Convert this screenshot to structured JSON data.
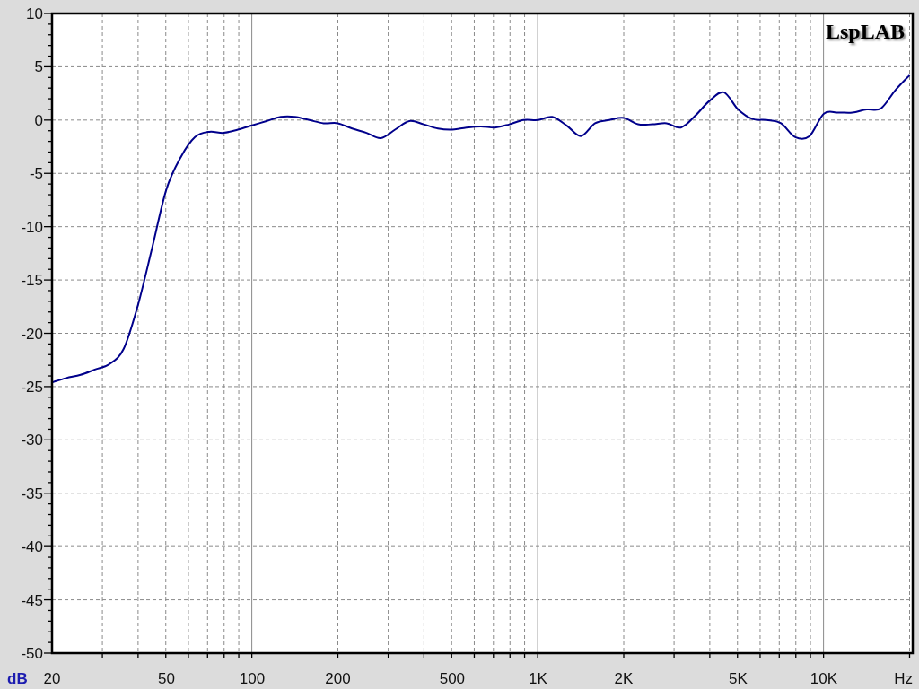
{
  "plot": {
    "brand": "LspLAB",
    "chart_data": {
      "type": "line",
      "xlabel": "Hz",
      "ylabel": "dB",
      "ylim": [
        -50,
        10
      ],
      "grid": true,
      "categories": [
        "20",
        null,
        null,
        null,
        null,
        null,
        null,
        null,
        "50",
        null,
        null,
        null,
        null,
        null,
        "100",
        null,
        null,
        null,
        null,
        null,
        "200",
        null,
        null,
        null,
        null,
        null,
        null,
        null,
        "500",
        null,
        null,
        null,
        null,
        null,
        "1K",
        null,
        null,
        null,
        null,
        null,
        "2K",
        null,
        null,
        null,
        null,
        null,
        null,
        null,
        "5K",
        null,
        null,
        null,
        null,
        null,
        "10K",
        null,
        null,
        null,
        null,
        null,
        null
      ],
      "yticks": [
        10,
        5,
        0,
        -5,
        -10,
        -15,
        -20,
        -25,
        -30,
        -35,
        -40,
        -45,
        -50
      ],
      "series": [
        {
          "color": "#00008b",
          "values": [
            -24.6,
            -24.2,
            -23.9,
            -23.4,
            -22.9,
            -21.5,
            -17.4,
            -12,
            -6.5,
            -3.5,
            -1.6,
            -1.1,
            -1.2,
            -0.9,
            -0.5,
            -0.1,
            0.3,
            0.3,
            0,
            -0.3,
            -0.3,
            -0.8,
            -1.2,
            -1.7,
            -0.9,
            -0.1,
            -0.4,
            -0.8,
            -0.9,
            -0.7,
            -0.6,
            -0.7,
            -0.4,
            0,
            0,
            0.3,
            -0.5,
            -1.5,
            -0.3,
            0,
            0.2,
            -0.4,
            -0.4,
            -0.3,
            -0.7,
            0.4,
            1.8,
            2.6,
            1,
            0.1,
            0,
            -0.3,
            -1.6,
            -1.5,
            0.6,
            0.7,
            0.7,
            1,
            1.1,
            2.8,
            4.2
          ]
        }
      ]
    }
  }
}
